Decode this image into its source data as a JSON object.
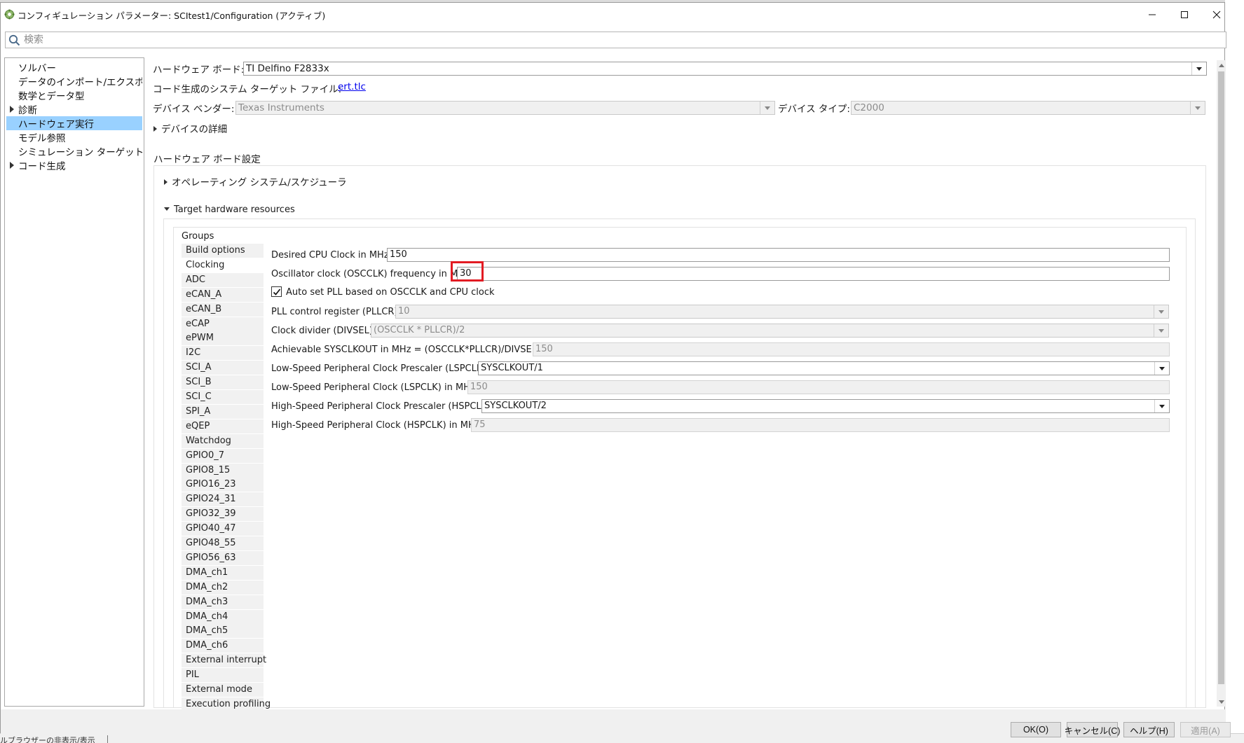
{
  "window": {
    "title": "コンフィギュレーション パラメーター: SCItest1/Configuration (アクティブ)",
    "minimize": "—",
    "maximize": "☐",
    "close": "✕"
  },
  "search": {
    "placeholder": "検索"
  },
  "tree": [
    {
      "label": "ソルバー",
      "expandable": false,
      "selected": false
    },
    {
      "label": "データのインポート/エクスポート",
      "expandable": false,
      "selected": false
    },
    {
      "label": "数学とデータ型",
      "expandable": false,
      "selected": false
    },
    {
      "label": "診断",
      "expandable": true,
      "selected": false
    },
    {
      "label": "ハードウェア実行",
      "expandable": false,
      "selected": true
    },
    {
      "label": "モデル参照",
      "expandable": false,
      "selected": false
    },
    {
      "label": "シミュレーション ターゲット",
      "expandable": false,
      "selected": false
    },
    {
      "label": "コード生成",
      "expandable": true,
      "selected": false
    }
  ],
  "hardware": {
    "board_label": "ハードウェア ボード:",
    "board_value": "TI Delfino F2833x",
    "system_target_label": "コード生成のシステム ターゲット ファイル:",
    "system_target_link": "ert.tlc",
    "vendor_label": "デバイス ベンダー:",
    "vendor_value": "Texas Instruments",
    "type_label": "デバイス タイプ:",
    "type_value": "C2000",
    "device_details": "デバイスの詳細",
    "board_settings": "ハードウェア ボード設定",
    "os_scheduler": "オペレーティング システム/スケジューラ",
    "target_resources": "Target hardware resources",
    "groups_label": "Groups"
  },
  "groups": [
    "Build options",
    "Clocking",
    "ADC",
    "eCAN_A",
    "eCAN_B",
    "eCAP",
    "ePWM",
    "I2C",
    "SCI_A",
    "SCI_B",
    "SCI_C",
    "SPI_A",
    "eQEP",
    "Watchdog",
    "GPIO0_7",
    "GPIO8_15",
    "GPIO16_23",
    "GPIO24_31",
    "GPIO32_39",
    "GPIO40_47",
    "GPIO48_55",
    "GPIO56_63",
    "DMA_ch1",
    "DMA_ch2",
    "DMA_ch3",
    "DMA_ch4",
    "DMA_ch5",
    "DMA_ch6",
    "External interrupt",
    "PIL",
    "External mode",
    "Execution profiling"
  ],
  "selected_group": "Clocking",
  "clocking": {
    "cpu_clock_label": "Desired CPU Clock in MHz:",
    "cpu_clock_value": "150",
    "osc_label": "Oscillator clock (OSCCLK) frequency in MHz:",
    "osc_value": "30",
    "auto_pll_label": "Auto set PLL based on OSCCLK and CPU clock",
    "auto_pll_checked": true,
    "pllcr_label": "PLL control register (PLLCR):",
    "pllcr_value": "10",
    "divsel_label": "Clock divider (DIVSEL):",
    "divsel_value": "(OSCCLK * PLLCR)/2",
    "sysclk_label": "Achievable SYSCLKOUT in MHz = (OSCCLK*PLLCR)/DIVSEL:",
    "sysclk_value": "150",
    "lspclk_prescaler_label": "Low-Speed Peripheral Clock Prescaler (LSPCLK):",
    "lspclk_prescaler_value": "SYSCLKOUT/1",
    "lspclk_label": "Low-Speed Peripheral Clock (LSPCLK) in MHz:",
    "lspclk_value": "150",
    "hspclk_prescaler_label": "High-Speed Peripheral Clock Prescaler (HSPCLK):",
    "hspclk_prescaler_value": "SYSCLKOUT/2",
    "hspclk_label": "High-Speed Peripheral Clock (HSPCLK) in MHz:",
    "hspclk_value": "75"
  },
  "footer": {
    "ok": "OK(O)",
    "cancel": "キャンセル(C)",
    "help": "ヘルプ(H)",
    "apply": "適用(A)"
  },
  "background": {
    "statusbar_text": "ルブラウザーの非表示/表示"
  },
  "colors": {
    "selection": "#99d1ff",
    "highlight_box": "#e21b23",
    "link": "#0000ee"
  }
}
